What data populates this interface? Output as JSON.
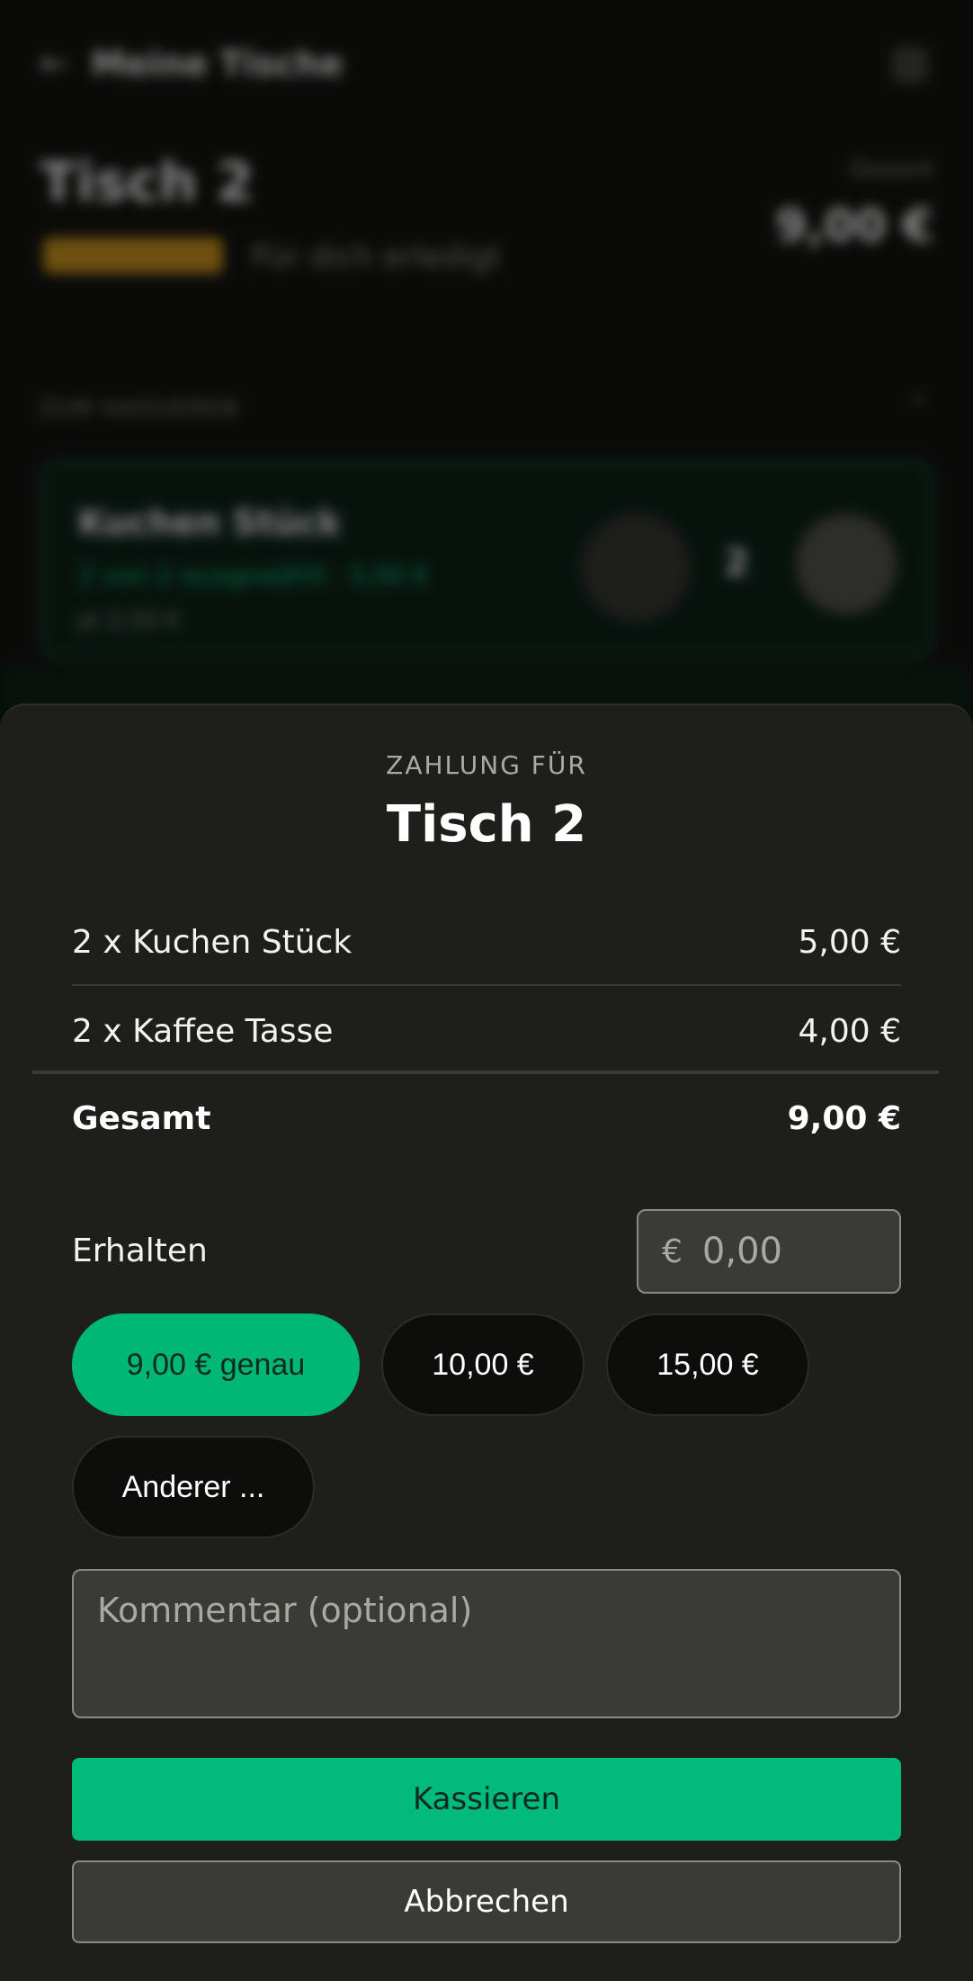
{
  "background": {
    "nav_back_icon": "arrow-left-icon",
    "nav_title": "Meine Tische",
    "table_title": "Tisch 2",
    "status_badge": "OFFEN",
    "status_text": "Für dich erledigt",
    "total_label": "Gesamt",
    "total_value": "9,00 €",
    "section_label": "ZUM KASSIEREN",
    "item_name": "Kuchen Stück",
    "item_green_line": "2 von 2 ausgewählt · 5,00 €",
    "item_sub": "je 2,50 €",
    "item_qty": "2"
  },
  "sheet": {
    "kicker": "ZAHLUNG FÜR",
    "title": "Tisch 2",
    "lines": [
      {
        "label": "2 x Kuchen Stück",
        "amount": "5,00 €"
      },
      {
        "label": "2 x Kaffee Tasse",
        "amount": "4,00 €"
      }
    ],
    "total": {
      "label": "Gesamt",
      "amount": "9,00 €"
    },
    "received": {
      "label": "Erhalten",
      "currency": "€",
      "placeholder": "0,00"
    },
    "quick_amounts": [
      {
        "label": "9,00 € genau",
        "selected": true
      },
      {
        "label": "10,00 €",
        "selected": false
      },
      {
        "label": "15,00 €",
        "selected": false
      },
      {
        "label": "Anderer ...",
        "selected": false
      }
    ],
    "comment_placeholder": "Kommentar (optional)",
    "primary_button": "Kassieren",
    "secondary_button": "Abbrechen"
  },
  "colors": {
    "accent": "#00B777",
    "sheet_bg": "#1E1F1B",
    "input_bg": "#3A3B36",
    "page_bg": "#0A0A09"
  }
}
